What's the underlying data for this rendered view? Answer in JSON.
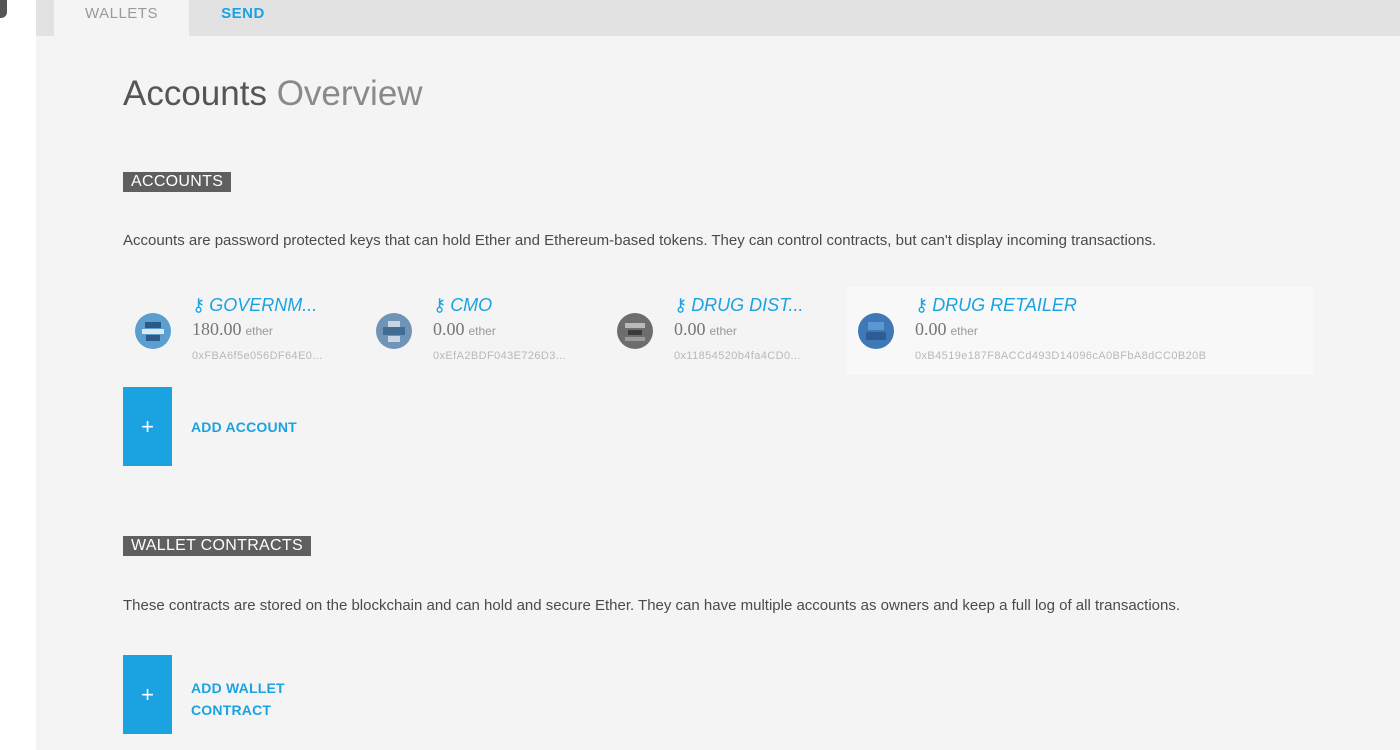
{
  "tabs": {
    "wallets": "WALLETS",
    "send": "SEND"
  },
  "page_title": {
    "strong": "Accounts",
    "light": "Overview"
  },
  "accounts_section": {
    "tag": "ACCOUNTS",
    "description": "Accounts are password protected keys that can hold Ether and Ethereum-based tokens. They can control contracts, but can't display incoming transactions.",
    "add_label": "ADD ACCOUNT",
    "add_icon": "+"
  },
  "accounts": [
    {
      "name": "GOVERNM...",
      "balance": "180.00",
      "unit": "ether",
      "address": "0xFBA6f5e056DF64E0...",
      "avatar": "identicon"
    },
    {
      "name": "CMO",
      "balance": "0.00",
      "unit": "ether",
      "address": "0xEfA2BDF043E726D3...",
      "avatar": "identicon"
    },
    {
      "name": "DRUG DIST...",
      "balance": "0.00",
      "unit": "ether",
      "address": "0x11854520b4fa4CD0...",
      "avatar": "identicon"
    },
    {
      "name": "DRUG RETAILER",
      "balance": "0.00",
      "unit": "ether",
      "address": "0xB4519e187F8ACCd493D14096cA0BFbA8dCC0B20B",
      "avatar": "identicon"
    }
  ],
  "wallet_section": {
    "tag": "WALLET CONTRACTS",
    "description": "These contracts are stored on the blockchain and can hold and secure Ether. They can have multiple accounts as owners and keep a full log of all transactions.",
    "add_label_line1": "ADD WALLET",
    "add_label_line2": "CONTRACT",
    "add_icon": "+"
  },
  "icons": {
    "key": "key-icon",
    "add": "plus-icon"
  },
  "colors": {
    "accent": "#1aa3e0",
    "tag_bg": "#5f5f5f"
  }
}
